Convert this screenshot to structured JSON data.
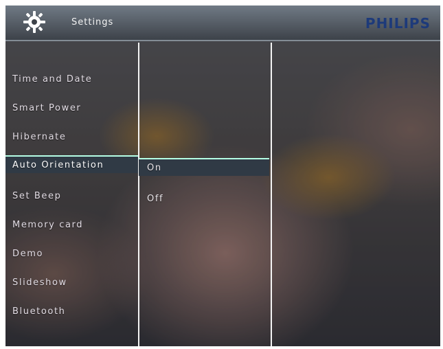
{
  "header": {
    "title": "Settings",
    "brand": "PHILIPS"
  },
  "menu": {
    "items": [
      {
        "label": "Time and Date"
      },
      {
        "label": "Smart Power"
      },
      {
        "label": "Hibernate"
      },
      {
        "label": "Auto Orientation",
        "selected": true
      },
      {
        "label": "Set Beep"
      },
      {
        "label": "Memory card"
      },
      {
        "label": "Demo"
      },
      {
        "label": "Slideshow"
      },
      {
        "label": "Bluetooth"
      }
    ]
  },
  "submenu": {
    "options": [
      {
        "label": "On",
        "selected": true
      },
      {
        "label": "Off"
      }
    ]
  },
  "colors": {
    "brand": "#1d3a7a",
    "highlight": "#303a45",
    "highlight_border": "#b5ffe6"
  },
  "icons": {
    "settings": "gear-icon"
  }
}
